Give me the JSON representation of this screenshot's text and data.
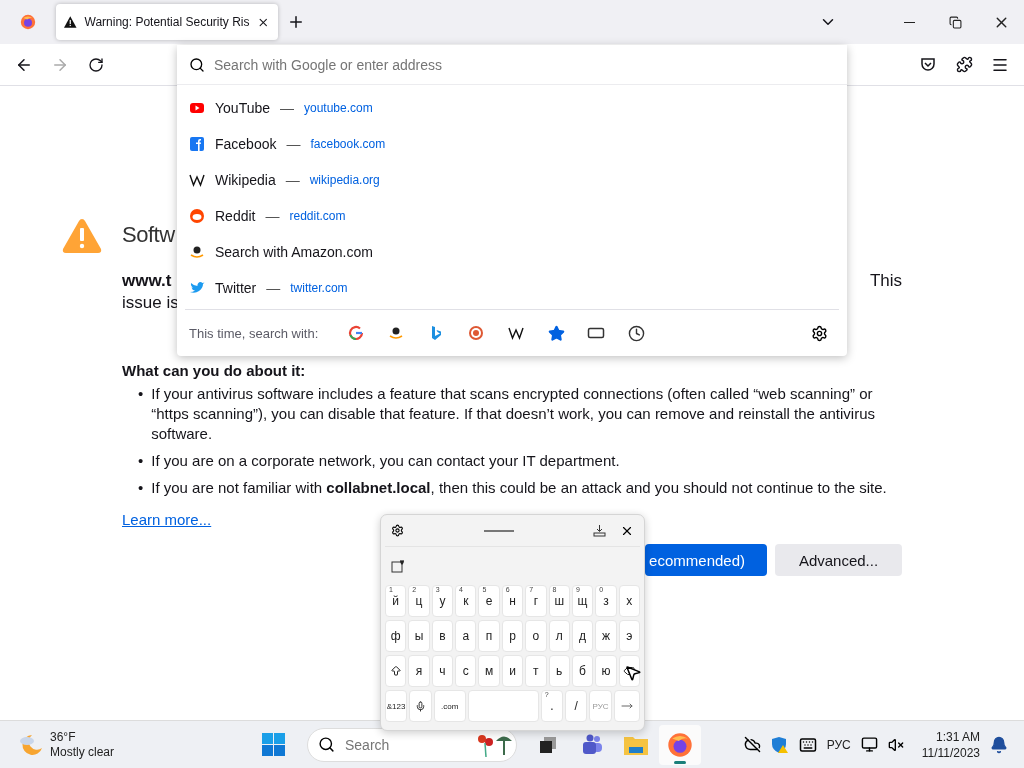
{
  "tabs": [
    {
      "title": "Warning: Potential Security Ris",
      "selected": true
    }
  ],
  "address_bar": {
    "placeholder": "Search with Google or enter address"
  },
  "suggestions": [
    {
      "kind": "youtube",
      "title": "YouTube",
      "separator": "—",
      "url": "youtube.com"
    },
    {
      "kind": "facebook",
      "title": "Facebook",
      "separator": "—",
      "url": "facebook.com"
    },
    {
      "kind": "wikipedia",
      "title": "Wikipedia",
      "separator": "—",
      "url": "wikipedia.org"
    },
    {
      "kind": "reddit",
      "title": "Reddit",
      "separator": "—",
      "url": "reddit.com"
    },
    {
      "kind": "amazon",
      "title": "Search with Amazon.com"
    },
    {
      "kind": "twitter",
      "title": "Twitter",
      "separator": "—",
      "url": "twitter.com"
    }
  ],
  "one_offs": {
    "label": "This time, search with:",
    "engines": [
      {
        "kind": "google"
      },
      {
        "kind": "amazon"
      },
      {
        "kind": "bing"
      },
      {
        "kind": "duckduckgo"
      },
      {
        "kind": "wikipedia"
      },
      {
        "kind": "bookmarks"
      },
      {
        "kind": "tabs"
      },
      {
        "kind": "history"
      }
    ]
  },
  "page": {
    "title": "Softw",
    "host": "www.t",
    "line_end": "This",
    "line2": "issue is",
    "heading": "What can you do about it:",
    "bullet_marker": "•",
    "bullets": [
      "If your antivirus software includes a feature that scans encrypted connections (often called “web scanning” or “https scanning”), you can disable that feature. If that doesn’t work, you can remove and reinstall the antivirus software.",
      "If you are on a corporate network, you can contact your IT department.",
      "If you are not familiar with **collabnet.local**, then this could be an attack and you should not continue to the site."
    ],
    "learn_more": "Learn more...",
    "buttons": [
      {
        "kind": "primary",
        "label": "ecommended)"
      },
      {
        "kind": "secondary",
        "label": "Advanced..."
      }
    ]
  },
  "keyboard": {
    "rows": [
      [
        {
          "kind": "char",
          "label": "й",
          "hint": "1"
        },
        {
          "kind": "char",
          "label": "ц",
          "hint": "2"
        },
        {
          "kind": "char",
          "label": "у",
          "hint": "3"
        },
        {
          "kind": "char",
          "label": "к",
          "hint": "4"
        },
        {
          "kind": "char",
          "label": "е",
          "hint": "5"
        },
        {
          "kind": "char",
          "label": "н",
          "hint": "6"
        },
        {
          "kind": "char",
          "label": "г",
          "hint": "7"
        },
        {
          "kind": "char",
          "label": "ш",
          "hint": "8"
        },
        {
          "kind": "char",
          "label": "щ",
          "hint": "9"
        },
        {
          "kind": "char",
          "label": "з",
          "hint": "0"
        },
        {
          "kind": "char",
          "label": "х"
        }
      ],
      [
        {
          "kind": "char",
          "label": "ф"
        },
        {
          "kind": "char",
          "label": "ы"
        },
        {
          "kind": "char",
          "label": "в"
        },
        {
          "kind": "char",
          "label": "а"
        },
        {
          "kind": "char",
          "label": "п"
        },
        {
          "kind": "char",
          "label": "р"
        },
        {
          "kind": "char",
          "label": "о"
        },
        {
          "kind": "char",
          "label": "л"
        },
        {
          "kind": "char",
          "label": "д"
        },
        {
          "kind": "char",
          "label": "ж"
        },
        {
          "kind": "char",
          "label": "э"
        }
      ],
      [
        {
          "kind": "shift"
        },
        {
          "kind": "char",
          "label": "я"
        },
        {
          "kind": "char",
          "label": "ч"
        },
        {
          "kind": "char",
          "label": "с"
        },
        {
          "kind": "char",
          "label": "м"
        },
        {
          "kind": "char",
          "label": "и"
        },
        {
          "kind": "char",
          "label": "т"
        },
        {
          "kind": "char",
          "label": "ь"
        },
        {
          "kind": "char",
          "label": "б"
        },
        {
          "kind": "char",
          "label": "ю"
        },
        {
          "kind": "backspace"
        }
      ]
    ],
    "bottom_keys": [
      {
        "kind": "small",
        "label": "&123"
      },
      {
        "kind": "mic"
      },
      {
        "kind": "wide",
        "label": ".com"
      },
      {
        "kind": "space"
      },
      {
        "kind": "char",
        "label": ".",
        "hint": "?"
      },
      {
        "kind": "char",
        "label": "/"
      },
      {
        "kind": "faint",
        "label": "РУС"
      },
      {
        "kind": "enter"
      }
    ]
  },
  "taskbar": {
    "weather": {
      "temp": "36°F",
      "condition": "Mostly clear"
    },
    "search": {
      "placeholder": "Search"
    },
    "apps": [
      {
        "kind": "taskview",
        "selected": false
      },
      {
        "kind": "teams",
        "selected": false
      },
      {
        "kind": "explorer",
        "selected": false
      },
      {
        "kind": "firefox",
        "selected": true
      }
    ],
    "language": "РУС",
    "time": "1:31 AM",
    "date": "11/11/2023"
  }
}
